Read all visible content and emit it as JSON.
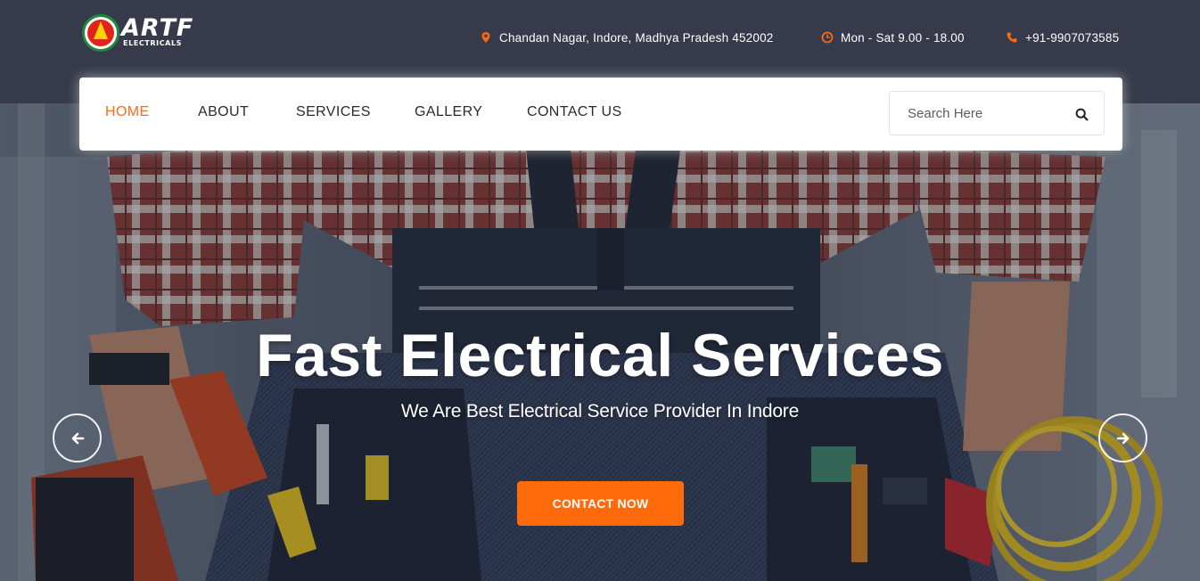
{
  "brand": {
    "name": "ARTF",
    "tagline": "ELECTRICALS"
  },
  "topbar": {
    "address": "Chandan Nagar, Indore, Madhya Pradesh 452002",
    "address_icon": "map-pin-icon",
    "hours": "Mon - Sat 9.00 - 18.00",
    "hours_icon": "clock-icon",
    "phone": "+91-9907073585",
    "phone_icon": "phone-icon",
    "icon_color": "#ff6b0a"
  },
  "nav": {
    "items": [
      {
        "label": "HOME",
        "active": true
      },
      {
        "label": "ABOUT",
        "active": false
      },
      {
        "label": "SERVICES",
        "active": false
      },
      {
        "label": "GALLERY",
        "active": false
      },
      {
        "label": "CONTACT US",
        "active": false
      }
    ],
    "active_color": "#f26b1d"
  },
  "search": {
    "placeholder": "Search Here",
    "value": "",
    "icon": "search-icon"
  },
  "hero": {
    "title": "Fast Electrical Services",
    "subtitle": "We Are Best Electrical Service Provider In Indore",
    "cta_label": "CONTACT NOW",
    "cta_color": "#ff6b0a",
    "prev_icon": "arrow-left-icon",
    "next_icon": "arrow-right-icon"
  },
  "colors": {
    "topbar_bg": "#373a4a",
    "accent": "#ff6b0a"
  }
}
